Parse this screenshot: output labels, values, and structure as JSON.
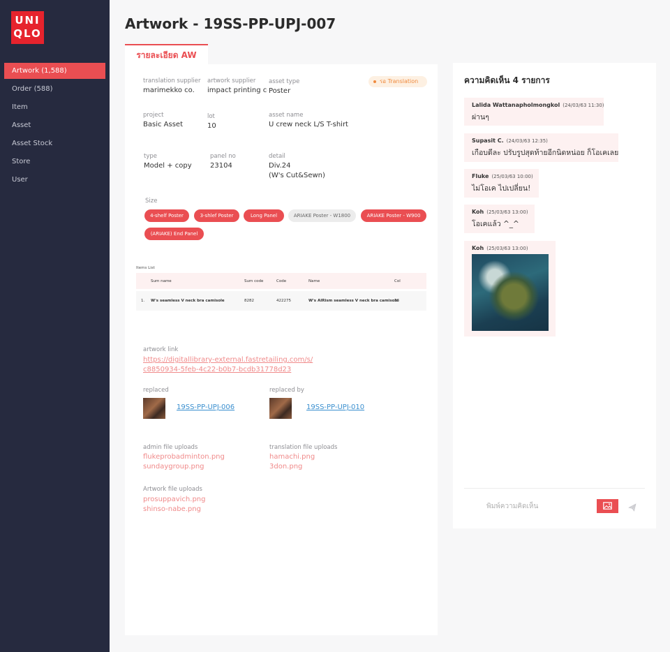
{
  "brand": {
    "logo_line1": "UNI",
    "logo_line2": "QLO",
    "color": "#e6232d"
  },
  "sidebar": {
    "items": [
      {
        "label": "Artwork (1,588)",
        "active": true
      },
      {
        "label": "Order (588)"
      },
      {
        "label": "Item"
      },
      {
        "label": "Asset"
      },
      {
        "label": "Asset Stock"
      },
      {
        "label": "Store"
      },
      {
        "label": "User"
      }
    ]
  },
  "header": {
    "title": "Artwork - 19SS-PP-UPJ-007"
  },
  "tab": {
    "label": "รายละเอียด AW"
  },
  "details": {
    "translation_supplier": {
      "label": "translation supplier",
      "value": "marimekko co."
    },
    "artwork_supplier": {
      "label": "artwork supplier",
      "value": "impact printing co"
    },
    "asset_type": {
      "label": "asset type",
      "value": "Poster"
    },
    "status_badge": "รอ Translation",
    "project": {
      "label": "project",
      "value": "Basic Asset"
    },
    "lot": {
      "label": "lot",
      "value": "10"
    },
    "asset_name": {
      "label": "asset name",
      "value": "U crew neck L/S T-shirt"
    },
    "type": {
      "label": "type",
      "value": "Model + copy"
    },
    "panel_no": {
      "label": "panel no",
      "value": "23104"
    },
    "detail": {
      "label": "detail",
      "line1": "Div.24",
      "line2": "(W's Cut&Sewn)"
    },
    "size": {
      "label": "Size",
      "pills": [
        "4-shelf Poster",
        "3-shlef Poster",
        "Long Panel",
        "ARIAKE  Poster - W1800",
        "ARIAKE  Poster - W900",
        "(ARIAKE)  End Panel"
      ]
    }
  },
  "items_list": {
    "label": "Items List",
    "columns": [
      "Sum name",
      "Sum code",
      "Code",
      "Name",
      "Col"
    ],
    "rows": [
      {
        "no": "1.",
        "sum_name": "W's seamless V neck bra camisole",
        "sum_code": "8282",
        "code": "422275",
        "name": "W's AIRism seamless V neck bra camisole",
        "col": "33"
      }
    ]
  },
  "artwork_link": {
    "label": "artwork link",
    "line1": "https://digitallibrary-external.fastretailing.com/s/",
    "line2": "c8850934-5feb-4c22-b0b7-bcdb31778d23"
  },
  "replaced": {
    "label": "replaced",
    "code": "19SS-PP-UPJ-006"
  },
  "replaced_by": {
    "label": "replaced by",
    "code": "19SS-PP-UPJ-010"
  },
  "admin_uploads": {
    "label": "admin file uploads",
    "files": [
      "flukeprobadminton.png",
      "sundaygroup.png"
    ]
  },
  "translation_uploads": {
    "label": "translation file uploads",
    "files": [
      "hamachi.png",
      "3don.png"
    ]
  },
  "artwork_uploads": {
    "label": "Artwork file uploads",
    "files": [
      "prosuppavich.png",
      "shinso-nabe.png"
    ]
  },
  "comments": {
    "title": "ความคิดเห็น 4 รายการ",
    "items": [
      {
        "name": "Lalida Wattanapholmongkol",
        "time": "(24/03/63 11:30)",
        "text": "ผ่านๆ"
      },
      {
        "name": "Supasit C.",
        "time": "(24/03/63 12:35)",
        "text": "เกือบดีละ ปรับรูปสุดท้ายอีกนิดหน่อย ก็โอเคเลย"
      },
      {
        "name": "Fluke",
        "time": "(25/03/63 10:00)",
        "text": "ไม่โอเค ไปเปลี่ยน!"
      },
      {
        "name": "Koh",
        "time": "(25/03/63 13:00)",
        "text": "โอเคแล้ว ^_^"
      },
      {
        "name": "Koh",
        "time": "(25/03/63 13:00)",
        "image": "aerial-coast-photo"
      }
    ],
    "input_placeholder": "พิมพ์ความคิดเห็น",
    "image_button_icon": "image-icon",
    "send_icon": "send-icon"
  },
  "colors": {
    "accent": "#ea4e52",
    "sidebar": "#262a3f",
    "badge_text": "#f08a3e",
    "link_blue": "#3a8fcf"
  }
}
